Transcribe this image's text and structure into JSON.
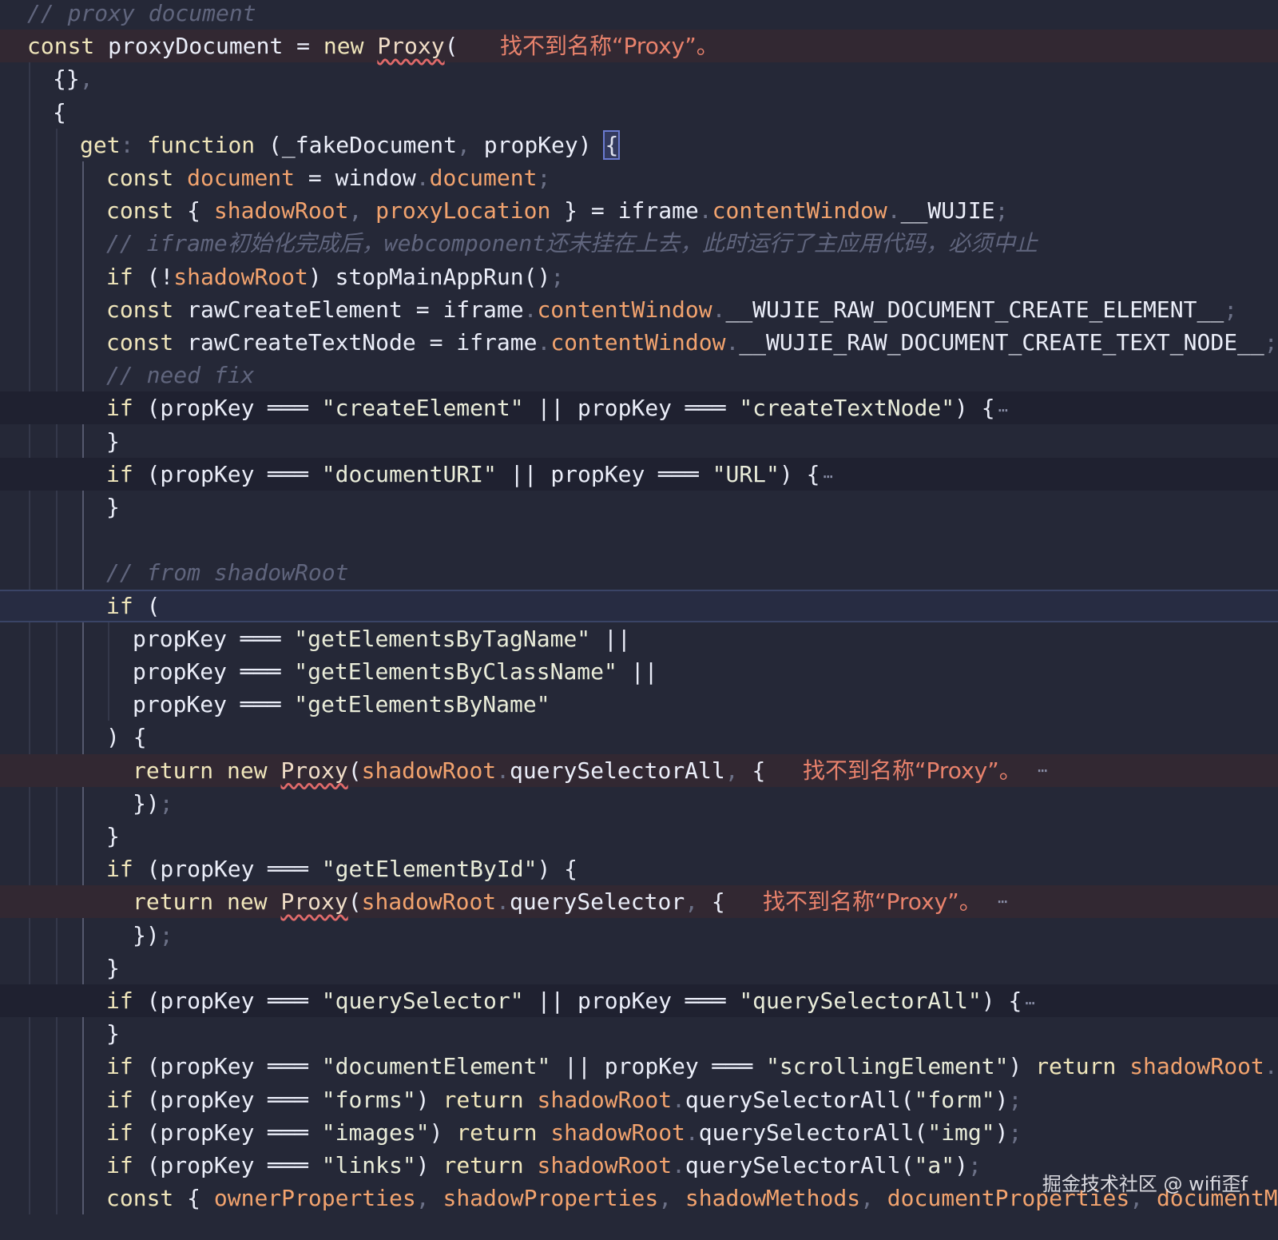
{
  "editor": {
    "lines": [
      {
        "tokens": [
          [
            "cmt",
            "// proxy document"
          ]
        ]
      },
      {
        "tokens": [
          [
            "kw",
            "const "
          ],
          [
            "id",
            "proxyDocument = "
          ],
          [
            "kw",
            "new "
          ],
          [
            "proxy",
            "Proxy"
          ],
          [
            "id",
            "("
          ]
        ],
        "diag": "找不到名称“Proxy”。"
      },
      {
        "tokens": [
          [
            "id",
            "{}"
          ],
          [
            "punc",
            ","
          ]
        ]
      },
      {
        "tokens": [
          [
            "id",
            "{"
          ]
        ]
      },
      {
        "tokens": [
          [
            "kw",
            "get"
          ],
          [
            "punc",
            ": "
          ],
          [
            "kw",
            "function "
          ],
          [
            "id",
            "(_fakeDocument"
          ],
          [
            "punc",
            ", "
          ],
          [
            "id",
            "propKey) "
          ],
          [
            "br",
            "{"
          ]
        ]
      },
      {
        "tokens": [
          [
            "kw",
            "const "
          ],
          [
            "prop",
            "document"
          ],
          [
            "id",
            " = window"
          ],
          [
            "punc",
            "."
          ],
          [
            "prop",
            "document"
          ],
          [
            "punc",
            ";"
          ]
        ]
      },
      {
        "tokens": [
          [
            "kw",
            "const "
          ],
          [
            "id",
            "{ "
          ],
          [
            "prop",
            "shadowRoot"
          ],
          [
            "punc",
            ", "
          ],
          [
            "prop",
            "proxyLocation"
          ],
          [
            "id",
            " } = iframe"
          ],
          [
            "punc",
            "."
          ],
          [
            "prop",
            "contentWindow"
          ],
          [
            "punc",
            "."
          ],
          [
            "id",
            "__WUJIE"
          ],
          [
            "punc",
            ";"
          ]
        ]
      },
      {
        "tokens": [
          [
            "cmt",
            "// iframe初始化完成后，webcomponent还未挂在上去，此时运行了主应用代码，必须中止"
          ]
        ]
      },
      {
        "tokens": [
          [
            "kw",
            "if "
          ],
          [
            "id",
            "(!"
          ],
          [
            "prop",
            "shadowRoot"
          ],
          [
            "id",
            ") stopMainAppRun()"
          ],
          [
            "punc",
            ";"
          ]
        ]
      },
      {
        "tokens": [
          [
            "kw",
            "const "
          ],
          [
            "id",
            "rawCreateElement = iframe"
          ],
          [
            "punc",
            "."
          ],
          [
            "prop",
            "contentWindow"
          ],
          [
            "punc",
            "."
          ],
          [
            "id",
            "__WUJIE_RAW_DOCUMENT_CREATE_ELEMENT__"
          ],
          [
            "punc",
            ";"
          ]
        ]
      },
      {
        "tokens": [
          [
            "kw",
            "const "
          ],
          [
            "id",
            "rawCreateTextNode = iframe"
          ],
          [
            "punc",
            "."
          ],
          [
            "prop",
            "contentWindow"
          ],
          [
            "punc",
            "."
          ],
          [
            "id",
            "__WUJIE_RAW_DOCUMENT_CREATE_TEXT_NODE__"
          ],
          [
            "punc",
            ";"
          ]
        ]
      },
      {
        "tokens": [
          [
            "cmt",
            "// need fix"
          ]
        ]
      },
      {
        "tokens": [
          [
            "kw",
            "if "
          ],
          [
            "id",
            "(propKey ═══ "
          ],
          [
            "str",
            "\"createElement\""
          ],
          [
            "id",
            " || propKey ═══ "
          ],
          [
            "str",
            "\"createTextNode\""
          ],
          [
            "id",
            ") {"
          ]
        ],
        "ellipsis": "⋯"
      },
      {
        "tokens": [
          [
            "id",
            "}"
          ]
        ]
      },
      {
        "tokens": [
          [
            "kw",
            "if "
          ],
          [
            "id",
            "(propKey ═══ "
          ],
          [
            "str",
            "\"documentURI\""
          ],
          [
            "id",
            " || propKey ═══ "
          ],
          [
            "str",
            "\"URL\""
          ],
          [
            "id",
            ") {"
          ]
        ],
        "ellipsis": "⋯"
      },
      {
        "tokens": [
          [
            "id",
            "}"
          ]
        ]
      },
      {
        "tokens": []
      },
      {
        "tokens": [
          [
            "cmt",
            "// from shadowRoot"
          ]
        ]
      },
      {
        "tokens": [
          [
            "kw",
            "if "
          ],
          [
            "id",
            "("
          ]
        ]
      },
      {
        "tokens": [
          [
            "id",
            "propKey ═══ "
          ],
          [
            "str",
            "\"getElementsByTagName\""
          ],
          [
            "id",
            " ||"
          ]
        ]
      },
      {
        "tokens": [
          [
            "id",
            "propKey ═══ "
          ],
          [
            "str",
            "\"getElementsByClassName\""
          ],
          [
            "id",
            " ||"
          ]
        ]
      },
      {
        "tokens": [
          [
            "id",
            "propKey ═══ "
          ],
          [
            "str",
            "\"getElementsByName\""
          ]
        ]
      },
      {
        "tokens": [
          [
            "id",
            ") {"
          ]
        ]
      },
      {
        "tokens": [
          [
            "kw",
            "return new "
          ],
          [
            "proxy",
            "Proxy"
          ],
          [
            "id",
            "("
          ],
          [
            "prop",
            "shadowRoot"
          ],
          [
            "punc",
            "."
          ],
          [
            "fn",
            "querySelectorAll"
          ],
          [
            "punc",
            ", "
          ],
          [
            "id",
            "{"
          ]
        ],
        "diag": "找不到名称“Proxy”。",
        "ellipsis": "⋯"
      },
      {
        "tokens": [
          [
            "id",
            "})"
          ],
          [
            "punc",
            ";"
          ]
        ]
      },
      {
        "tokens": [
          [
            "id",
            "}"
          ]
        ]
      },
      {
        "tokens": [
          [
            "kw",
            "if "
          ],
          [
            "id",
            "(propKey ═══ "
          ],
          [
            "str",
            "\"getElementById\""
          ],
          [
            "id",
            ") {"
          ]
        ]
      },
      {
        "tokens": [
          [
            "kw",
            "return new "
          ],
          [
            "proxy",
            "Proxy"
          ],
          [
            "id",
            "("
          ],
          [
            "prop",
            "shadowRoot"
          ],
          [
            "punc",
            "."
          ],
          [
            "fn",
            "querySelector"
          ],
          [
            "punc",
            ", "
          ],
          [
            "id",
            "{"
          ]
        ],
        "diag": "找不到名称“Proxy”。",
        "ellipsis": "⋯"
      },
      {
        "tokens": [
          [
            "id",
            "})"
          ],
          [
            "punc",
            ";"
          ]
        ]
      },
      {
        "tokens": [
          [
            "id",
            "}"
          ]
        ]
      },
      {
        "tokens": [
          [
            "kw",
            "if "
          ],
          [
            "id",
            "(propKey ═══ "
          ],
          [
            "str",
            "\"querySelector\""
          ],
          [
            "id",
            " || propKey ═══ "
          ],
          [
            "str",
            "\"querySelectorAll\""
          ],
          [
            "id",
            ") {"
          ]
        ],
        "ellipsis": "⋯"
      },
      {
        "tokens": [
          [
            "id",
            "}"
          ]
        ]
      },
      {
        "tokens": [
          [
            "kw",
            "if "
          ],
          [
            "id",
            "(propKey ═══ "
          ],
          [
            "str",
            "\"documentElement\""
          ],
          [
            "id",
            " || propKey ═══ "
          ],
          [
            "str",
            "\"scrollingElement\""
          ],
          [
            "id",
            ") "
          ],
          [
            "kw",
            "return "
          ],
          [
            "prop",
            "shadowRoot"
          ],
          [
            "punc",
            "."
          ]
        ]
      },
      {
        "tokens": [
          [
            "kw",
            "if "
          ],
          [
            "id",
            "(propKey ═══ "
          ],
          [
            "str",
            "\"forms\""
          ],
          [
            "id",
            ") "
          ],
          [
            "kw",
            "return "
          ],
          [
            "prop",
            "shadowRoot"
          ],
          [
            "punc",
            "."
          ],
          [
            "fn",
            "querySelectorAll"
          ],
          [
            "id",
            "("
          ],
          [
            "str",
            "\"form\""
          ],
          [
            "id",
            ")"
          ],
          [
            "punc",
            ";"
          ]
        ]
      },
      {
        "tokens": [
          [
            "kw",
            "if "
          ],
          [
            "id",
            "(propKey ═══ "
          ],
          [
            "str",
            "\"images\""
          ],
          [
            "id",
            ") "
          ],
          [
            "kw",
            "return "
          ],
          [
            "prop",
            "shadowRoot"
          ],
          [
            "punc",
            "."
          ],
          [
            "fn",
            "querySelectorAll"
          ],
          [
            "id",
            "("
          ],
          [
            "str",
            "\"img\""
          ],
          [
            "id",
            ")"
          ],
          [
            "punc",
            ";"
          ]
        ]
      },
      {
        "tokens": [
          [
            "kw",
            "if "
          ],
          [
            "id",
            "(propKey ═══ "
          ],
          [
            "str",
            "\"links\""
          ],
          [
            "id",
            ") "
          ],
          [
            "kw",
            "return "
          ],
          [
            "prop",
            "shadowRoot"
          ],
          [
            "punc",
            "."
          ],
          [
            "fn",
            "querySelectorAll"
          ],
          [
            "id",
            "("
          ],
          [
            "str",
            "\"a\""
          ],
          [
            "id",
            ")"
          ],
          [
            "punc",
            ";"
          ]
        ]
      },
      {
        "tokens": [
          [
            "kw",
            "const "
          ],
          [
            "id",
            "{ "
          ],
          [
            "prop",
            "ownerProperties"
          ],
          [
            "punc",
            ", "
          ],
          [
            "prop",
            "shadowProperties"
          ],
          [
            "punc",
            ", "
          ],
          [
            "prop",
            "shadowMethods"
          ],
          [
            "punc",
            ", "
          ],
          [
            "prop",
            "documentProperties"
          ],
          [
            "punc",
            ", "
          ],
          [
            "prop",
            "documentM"
          ]
        ]
      }
    ]
  },
  "watermark": "掘金技术社区 @ wifi歪f",
  "colors": {
    "background": "#252837",
    "diagnostic": "#e8826c",
    "keyword": "#f0e6bb",
    "property": "#f2a36e"
  }
}
